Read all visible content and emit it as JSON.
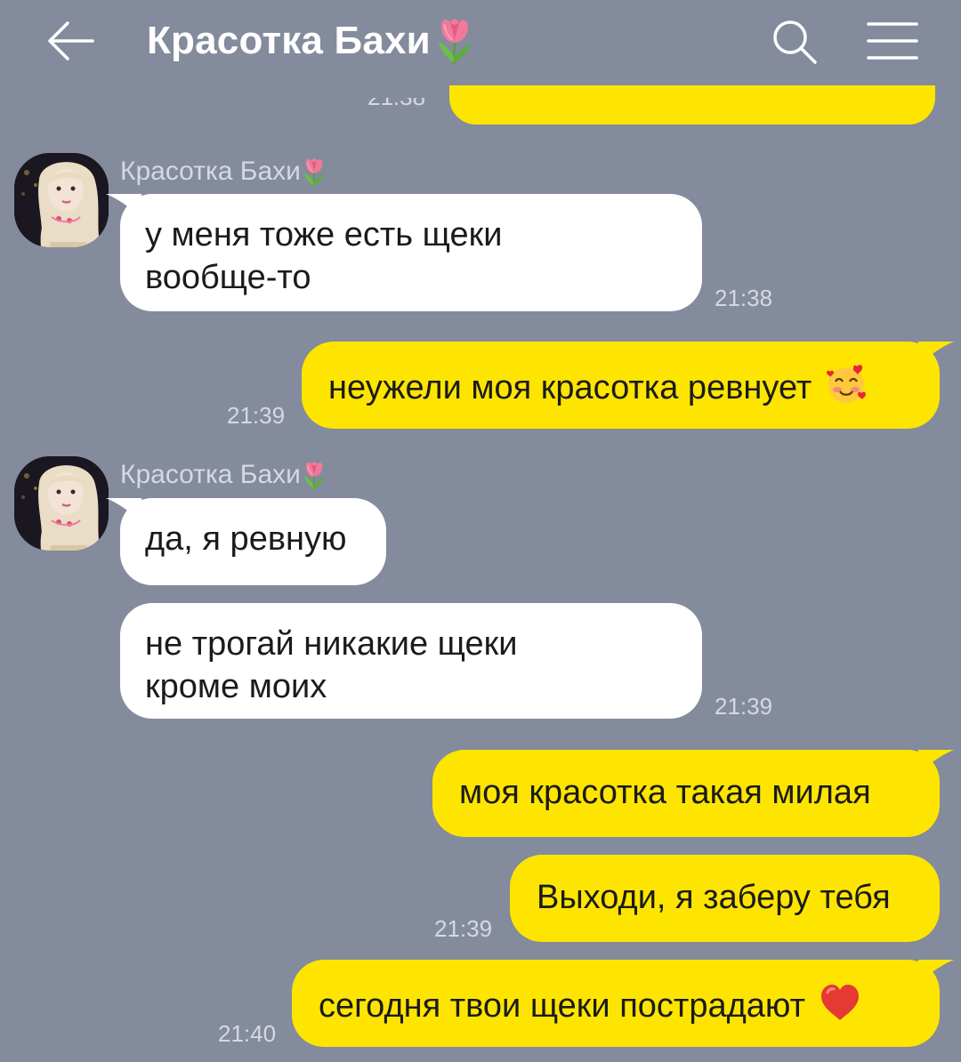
{
  "header": {
    "title": "Красотка Бахи",
    "back_icon": "arrow-left-icon",
    "search_icon": "search-icon",
    "menu_icon": "hamburger-menu-icon"
  },
  "colors": {
    "background": "#838b9d",
    "outgoing_bubble": "#fee500",
    "incoming_bubble": "#ffffff",
    "timestamp": "#d6d9e0"
  },
  "chat": {
    "partial_top_time": "21:38",
    "messages": [
      {
        "direction": "in",
        "sender": "Красотка Бахи",
        "text_lines": [
          "у меня тоже есть щеки",
          "вообще-то"
        ],
        "time": "21:38"
      },
      {
        "direction": "out",
        "text": "неужели моя красотка ревнует",
        "emoji": "smiling-face-with-hearts",
        "time": "21:39"
      },
      {
        "direction": "in",
        "sender": "Красотка Бахи",
        "text": "да, я ревную",
        "time": ""
      },
      {
        "direction": "in",
        "text_lines": [
          "не трогай никакие щеки",
          "кроме моих"
        ],
        "time": "21:39"
      },
      {
        "direction": "out",
        "text": "моя красотка такая милая",
        "time": ""
      },
      {
        "direction": "out",
        "text": "Выходи, я заберу тебя",
        "time": "21:39"
      },
      {
        "direction": "out",
        "text": "сегодня твои щеки пострадают",
        "emoji": "red-heart",
        "time": "21:40"
      }
    ]
  }
}
